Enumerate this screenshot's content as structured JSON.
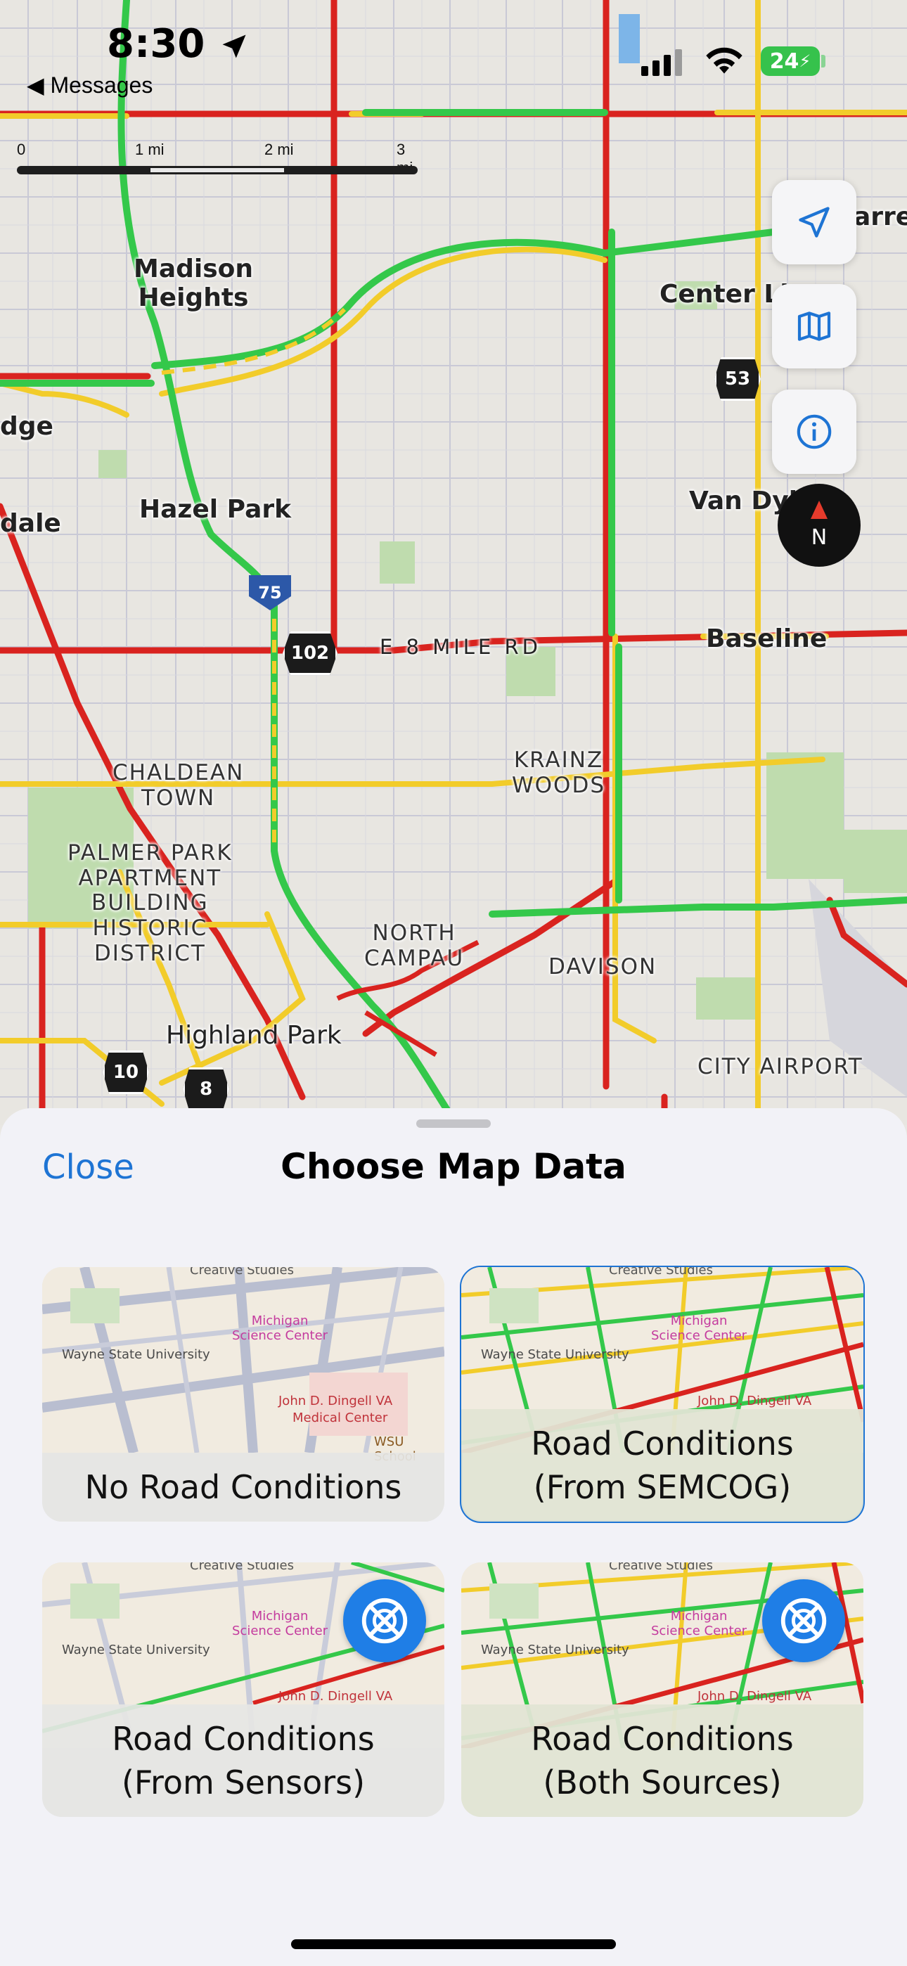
{
  "status_bar": {
    "time": "8:30",
    "back_label": "◀ Messages",
    "battery": "24"
  },
  "scale": {
    "ticks": [
      "0",
      "1 mi",
      "2 mi",
      "3 mi"
    ]
  },
  "map_labels": {
    "madison_heights": "Madison\nHeights",
    "hazel_park": "Hazel Park",
    "center_line": "Center Li",
    "warren": "arre",
    "van_dyke": "Van Dyke",
    "baseline": "Baseline",
    "e8mile": "E 8 MILE RD",
    "chaldean": "CHALDEAN\nTOWN",
    "krainz": "KRAINZ\nWOODS",
    "palmer": "PALMER PARK\nAPARTMENT\nBUILDING\nHISTORIC\nDISTRICT",
    "north_campau": "NORTH\nCAMPAU",
    "davison": "DAVISON",
    "highland_park": "Highland Park",
    "city_airport": "CITY AIRPORT",
    "edge_dge": "dge",
    "edge_dale": "dale"
  },
  "shields": {
    "i75": "75",
    "m102": "102",
    "m53": "53",
    "m10": "10",
    "m8": "8"
  },
  "compass_label": "N",
  "sheet": {
    "close_label": "Close",
    "title": "Choose Map Data",
    "options": [
      {
        "label": "No Road Conditions",
        "selected": false,
        "badge": false
      },
      {
        "label": "Road Conditions\n(From SEMCOG)",
        "selected": true,
        "badge": false
      },
      {
        "label": "Road Conditions\n(From Sensors)",
        "selected": false,
        "badge": true
      },
      {
        "label": "Road Conditions\n(Both Sources)",
        "selected": false,
        "badge": true
      }
    ],
    "thumb_labels": {
      "creative": "Creative Studies",
      "wayne": "Wayne State University",
      "michigan": "Michigan\nScience Center",
      "dingell": "John D. Dingell VA",
      "medical": "Medical Center",
      "wsu": "WSU School"
    }
  },
  "colors": {
    "accent": "#1e74d4",
    "traffic_green": "#34c84a",
    "traffic_yellow": "#f2cc2a",
    "traffic_red": "#d9231f"
  }
}
